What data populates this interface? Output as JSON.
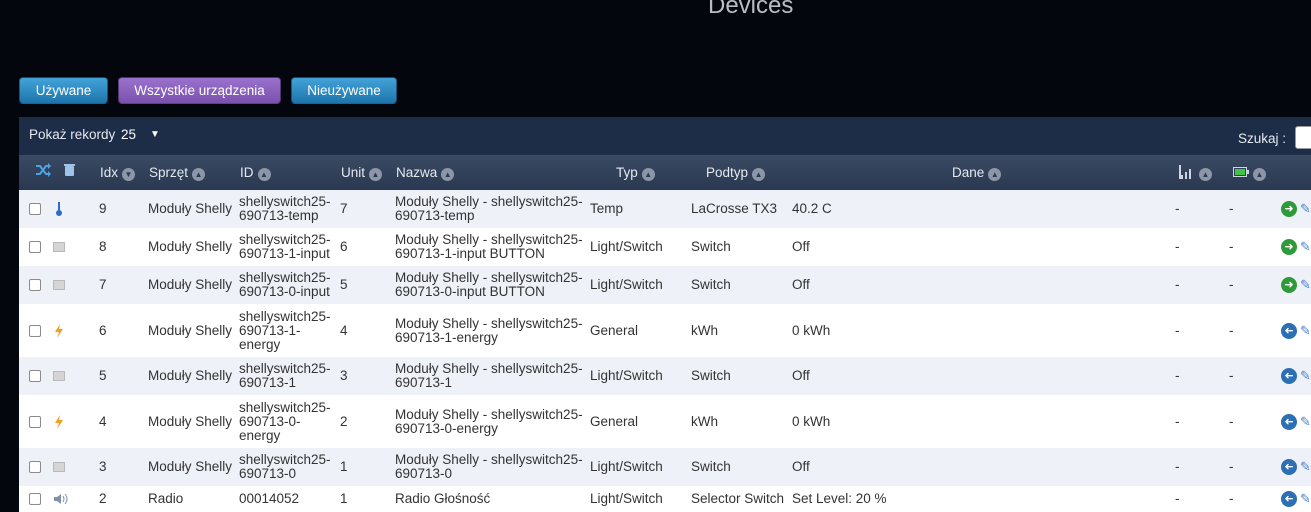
{
  "page": {
    "title": "Devices"
  },
  "filters": {
    "used": "Używane",
    "all": "Wszystkie urządzenia",
    "unused": "Nieużywane"
  },
  "toolbar": {
    "show_label": "Pokaż rekordy",
    "records": "25",
    "search_label": "Szukaj :"
  },
  "columns": {
    "idx": "Idx",
    "hardware": "Sprzęt",
    "id": "ID",
    "unit": "Unit",
    "name": "Nazwa",
    "type": "Typ",
    "subtype": "Podtyp",
    "data": "Dane"
  },
  "colors": {
    "accent_blue": "#1d76ab",
    "accent_purple": "#7a52ae",
    "header": "#1d2c47",
    "row_alt": "#eef1f8"
  },
  "rows": [
    {
      "idx": "9",
      "hw": "Moduły Shelly",
      "id": [
        "shellyswitch25-",
        "690713-temp"
      ],
      "unit": "7",
      "name": [
        "Moduły Shelly - shellyswitch25-",
        "690713-temp"
      ],
      "type": "Temp",
      "subtype": "LaCrosse TX3",
      "data": "40.2 C",
      "sig": "-",
      "bat": "-",
      "icon": "thermometer-icon",
      "action": "green"
    },
    {
      "idx": "8",
      "hw": "Moduły Shelly",
      "id": [
        "shellyswitch25-",
        "690713-1-input"
      ],
      "unit": "6",
      "name": [
        "Moduły Shelly - shellyswitch25-",
        "690713-1-input BUTTON"
      ],
      "type": "Light/Switch",
      "subtype": "Switch",
      "data": "Off",
      "sig": "-",
      "bat": "-",
      "icon": "switch-icon",
      "action": "green"
    },
    {
      "idx": "7",
      "hw": "Moduły Shelly",
      "id": [
        "shellyswitch25-",
        "690713-0-input"
      ],
      "unit": "5",
      "name": [
        "Moduły Shelly - shellyswitch25-",
        "690713-0-input BUTTON"
      ],
      "type": "Light/Switch",
      "subtype": "Switch",
      "data": "Off",
      "sig": "-",
      "bat": "-",
      "icon": "switch-icon",
      "action": "green"
    },
    {
      "idx": "6",
      "hw": "Moduły Shelly",
      "id": [
        "shellyswitch25-",
        "690713-1-",
        "energy"
      ],
      "unit": "4",
      "name": [
        "Moduły Shelly - shellyswitch25-",
        "690713-1-energy"
      ],
      "type": "General",
      "subtype": "kWh",
      "data": "0 kWh",
      "sig": "-",
      "bat": "-",
      "icon": "energy-icon",
      "action": "blue"
    },
    {
      "idx": "5",
      "hw": "Moduły Shelly",
      "id": [
        "shellyswitch25-",
        "690713-1"
      ],
      "unit": "3",
      "name": [
        "Moduły Shelly - shellyswitch25-",
        "690713-1"
      ],
      "type": "Light/Switch",
      "subtype": "Switch",
      "data": "Off",
      "sig": "-",
      "bat": "-",
      "icon": "switch-icon",
      "action": "blue"
    },
    {
      "idx": "4",
      "hw": "Moduły Shelly",
      "id": [
        "shellyswitch25-",
        "690713-0-",
        "energy"
      ],
      "unit": "2",
      "name": [
        "Moduły Shelly - shellyswitch25-",
        "690713-0-energy"
      ],
      "type": "General",
      "subtype": "kWh",
      "data": "0 kWh",
      "sig": "-",
      "bat": "-",
      "icon": "energy-icon",
      "action": "blue"
    },
    {
      "idx": "3",
      "hw": "Moduły Shelly",
      "id": [
        "shellyswitch25-",
        "690713-0"
      ],
      "unit": "1",
      "name": [
        "Moduły Shelly - shellyswitch25-",
        "690713-0"
      ],
      "type": "Light/Switch",
      "subtype": "Switch",
      "data": "Off",
      "sig": "-",
      "bat": "-",
      "icon": "switch-icon",
      "action": "blue"
    },
    {
      "idx": "2",
      "hw": "Radio",
      "id": [
        "00014052"
      ],
      "unit": "1",
      "name": [
        "Radio Głośność"
      ],
      "type": "Light/Switch",
      "subtype": "Selector Switch",
      "data": "Set Level: 20 %",
      "sig": "-",
      "bat": "-",
      "icon": "speaker-icon",
      "action": "blue"
    }
  ]
}
